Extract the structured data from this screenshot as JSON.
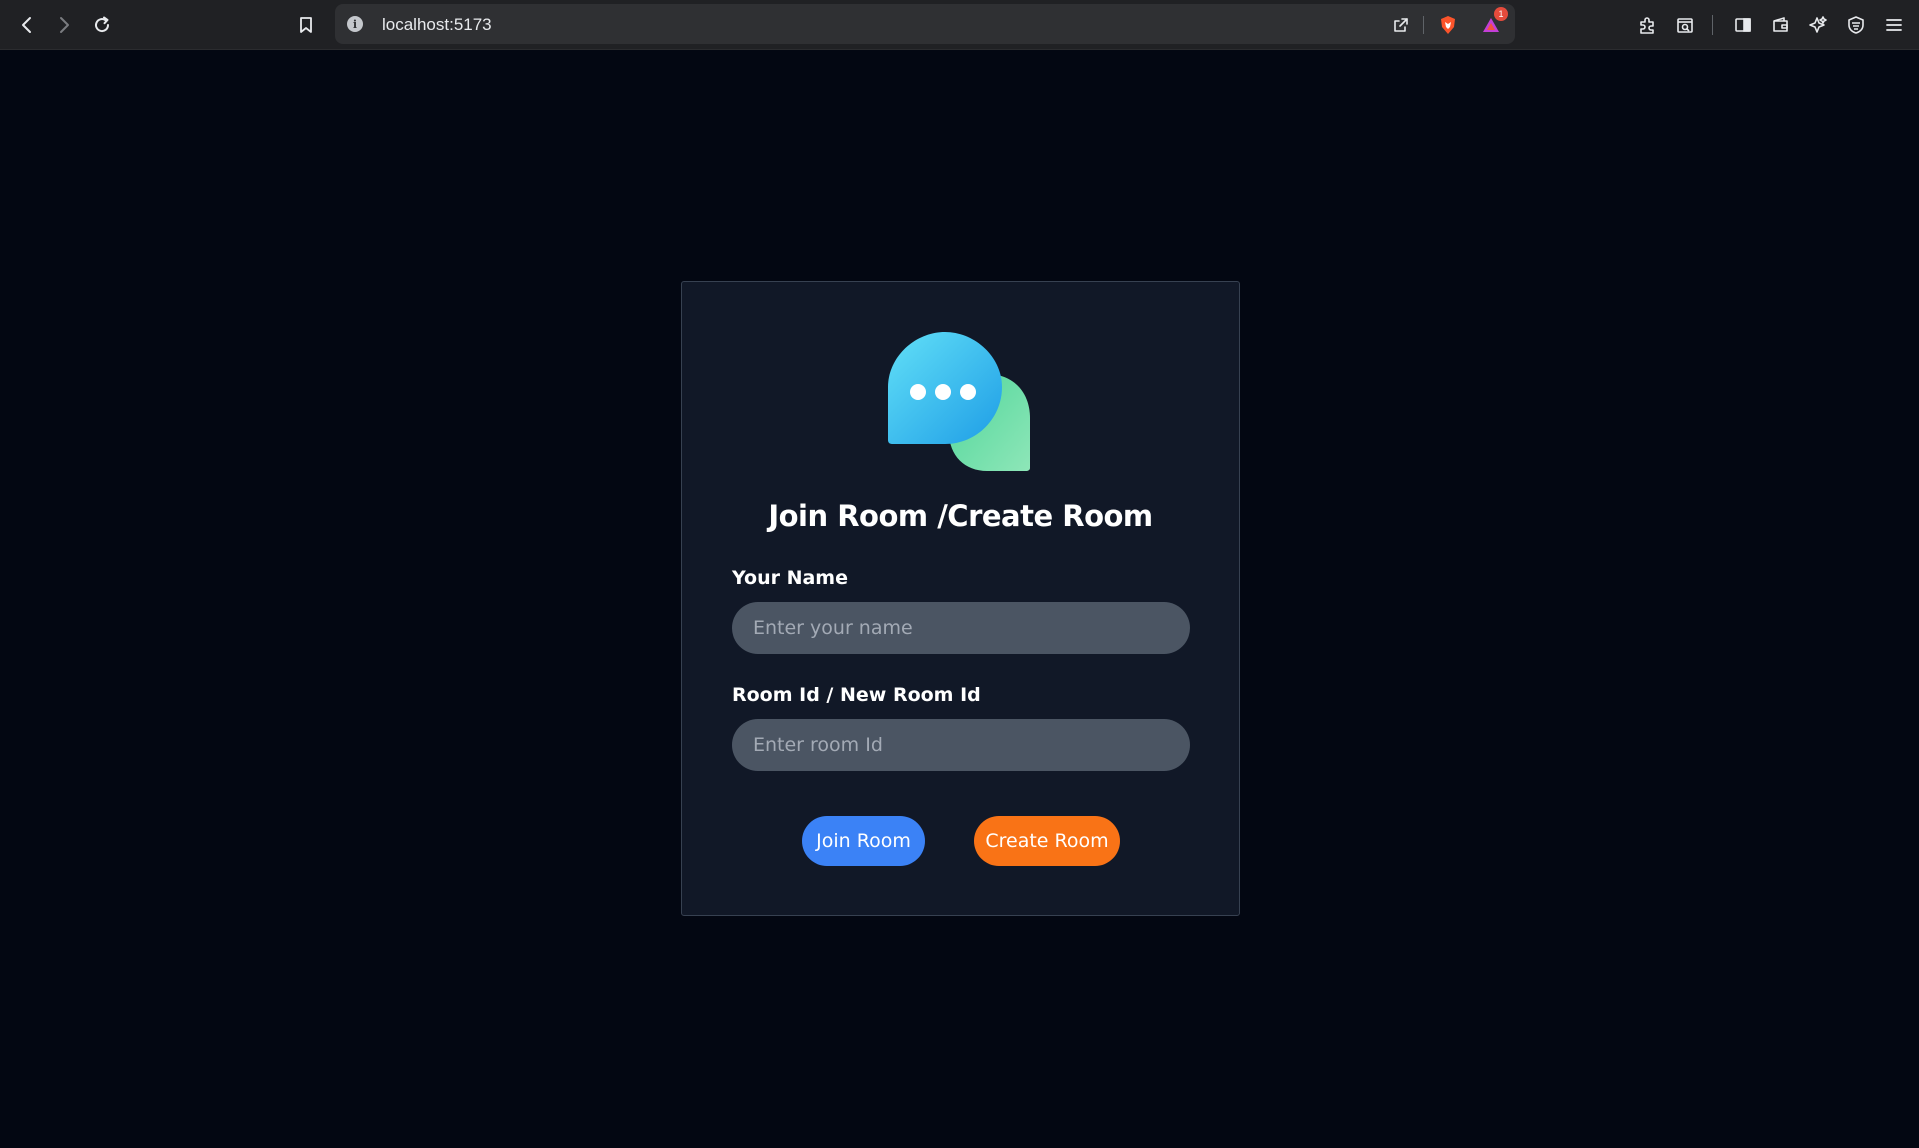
{
  "browser": {
    "url": "localhost:5173",
    "notification_count": "1"
  },
  "form": {
    "title": "Join Room /Create Room",
    "name_label": "Your Name",
    "name_placeholder": "Enter your name",
    "name_value": "",
    "room_label": "Room Id / New Room Id",
    "room_placeholder": "Enter room Id",
    "room_value": "",
    "join_button": "Join Room",
    "create_button": "Create Room"
  },
  "colors": {
    "page_background": "#030712",
    "card_background": "#111827",
    "input_background": "#4b5563",
    "join_button": "#3b82f6",
    "create_button": "#f97316"
  },
  "icons": {
    "logo": "chat-bubbles-icon"
  }
}
